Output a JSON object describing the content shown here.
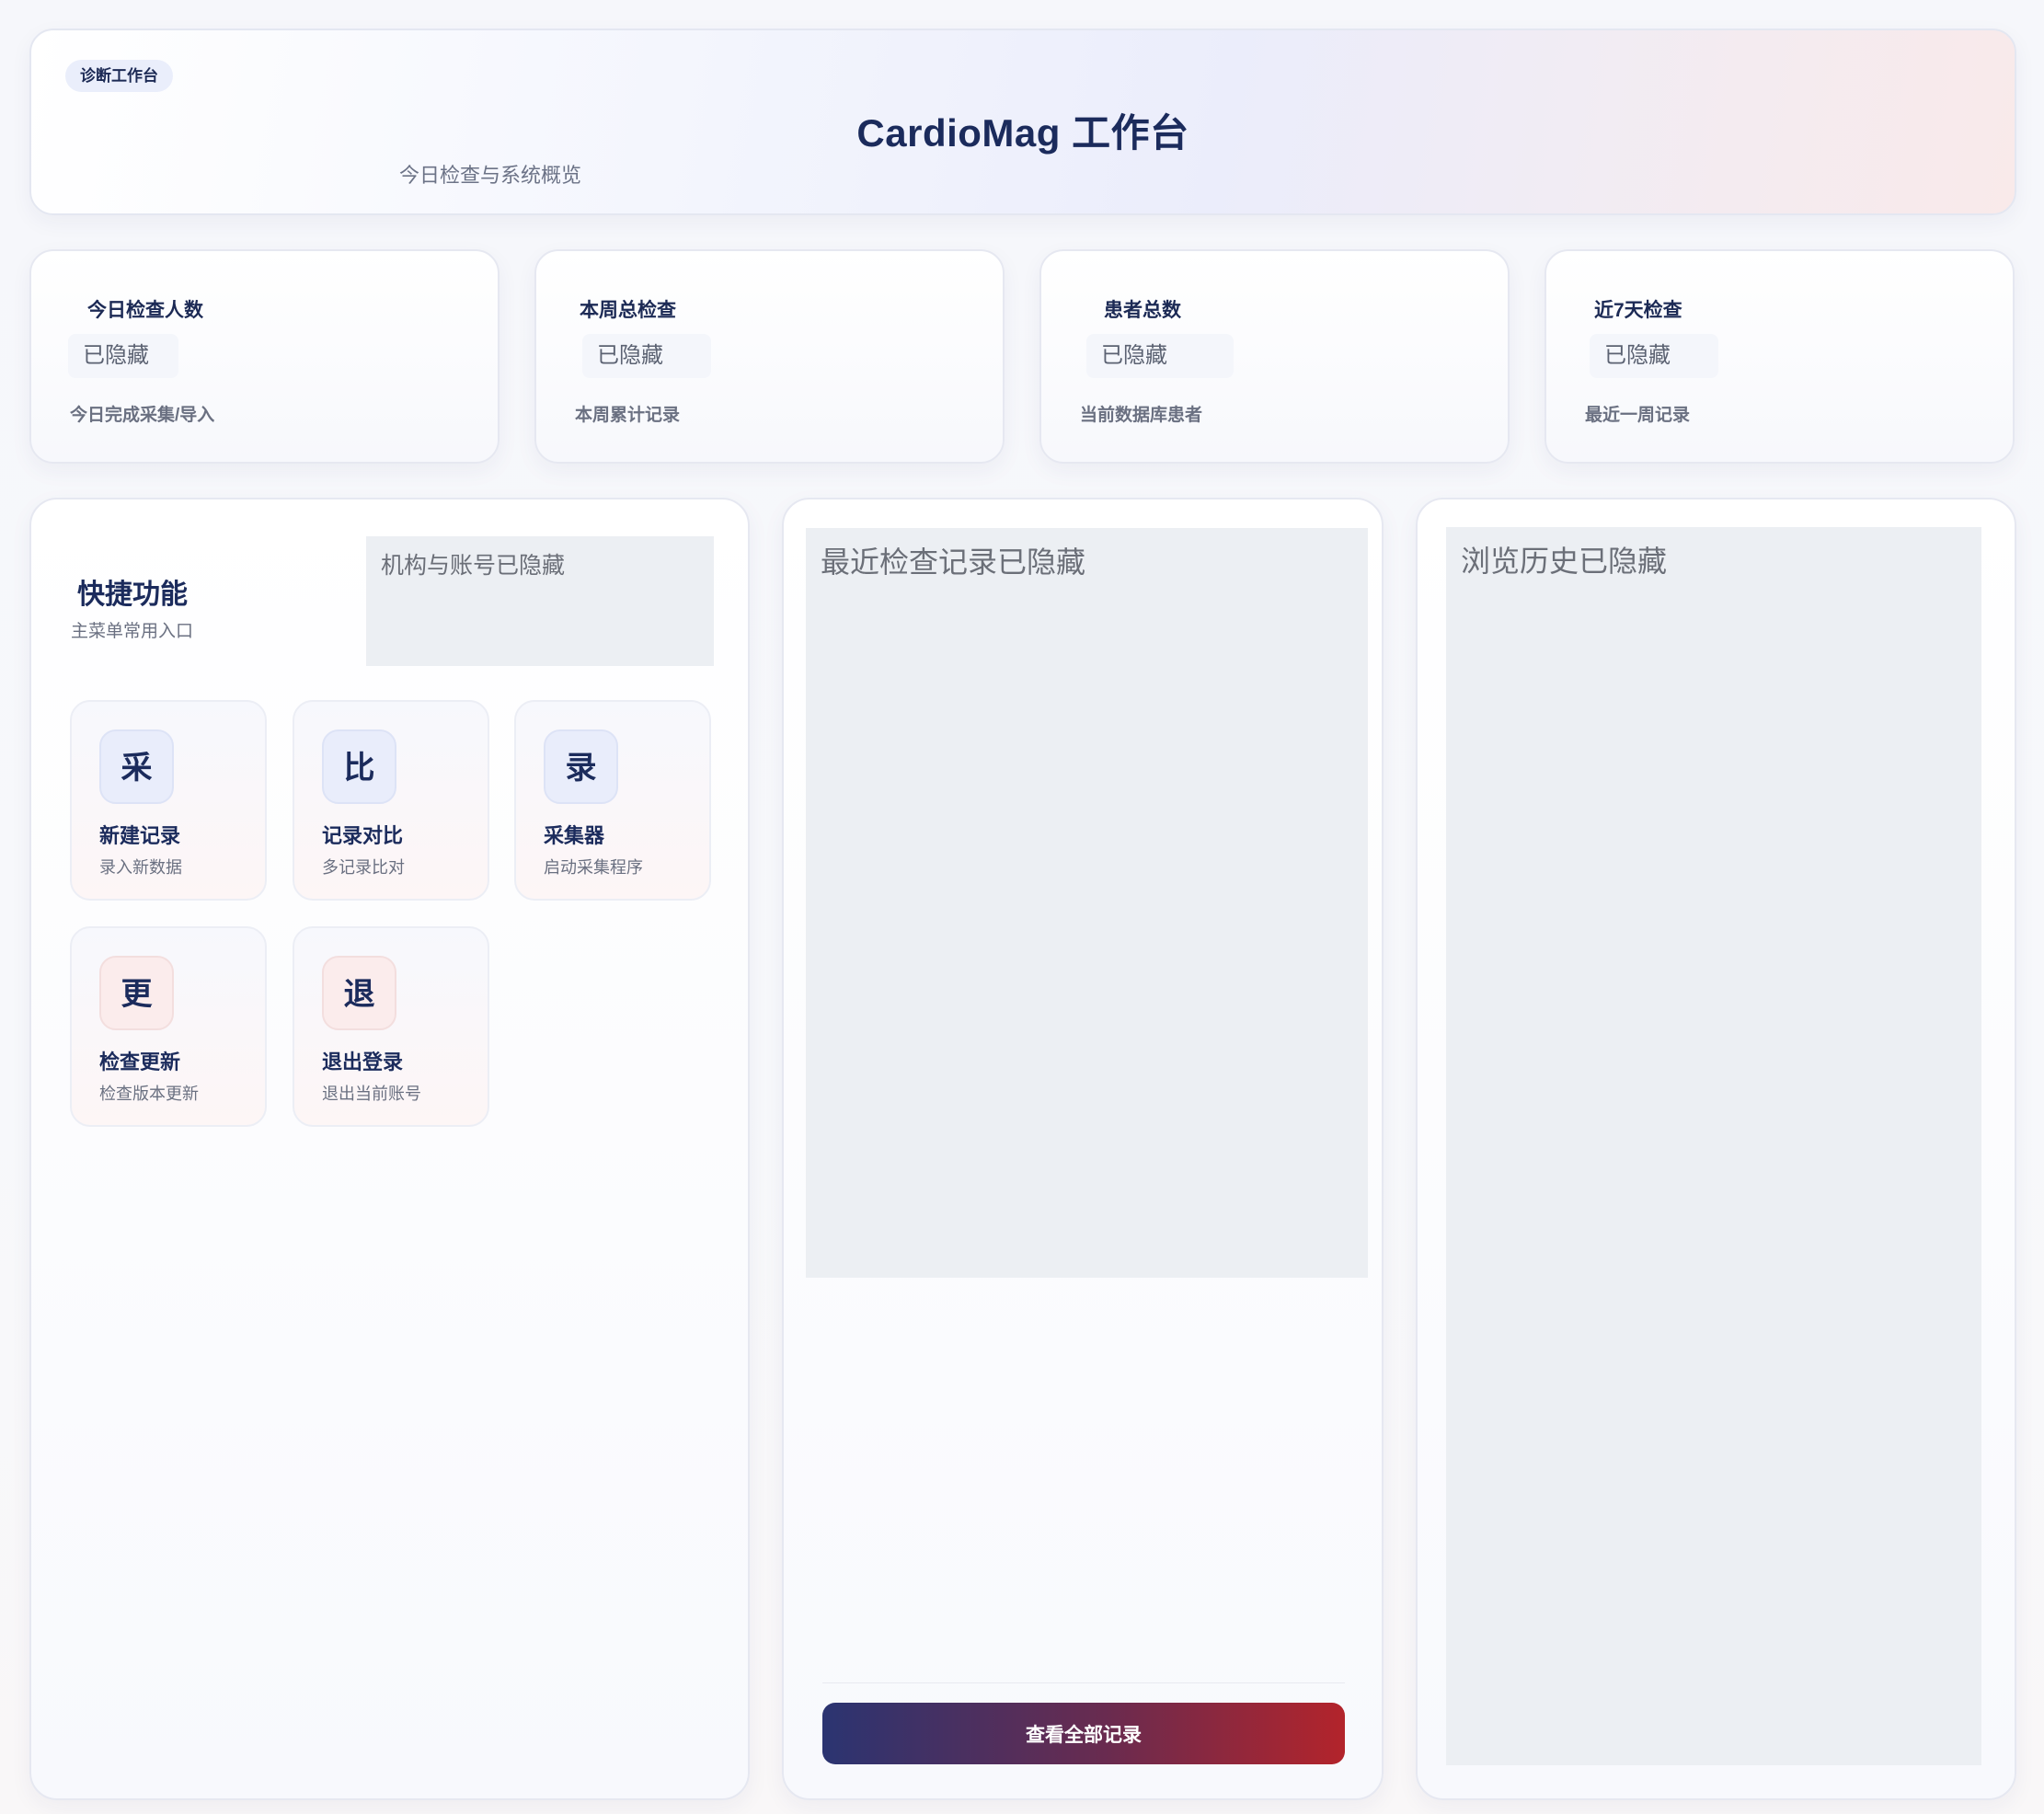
{
  "header": {
    "badge": "诊断工作台",
    "title": "CardioMag 工作台",
    "subtitle": "今日检查与系统概览"
  },
  "stats": [
    {
      "label": "今日检查人数",
      "value": "已隐藏",
      "desc": "今日完成采集/导入"
    },
    {
      "label": "本周总检查",
      "value": "已隐藏",
      "desc": "本周累计记录"
    },
    {
      "label": "患者总数",
      "value": "已隐藏",
      "desc": "当前数据库患者"
    },
    {
      "label": "近7天检查",
      "value": "已隐藏",
      "desc": "最近一周记录"
    }
  ],
  "quick": {
    "title": "快捷功能",
    "subtitle": "主菜单常用入口",
    "org_hidden": "机构与账号已隐藏",
    "tiles": [
      {
        "icon": "采",
        "title": "新建记录",
        "desc": "录入新数据"
      },
      {
        "icon": "比",
        "title": "记录对比",
        "desc": "多记录比对"
      },
      {
        "icon": "录",
        "title": "采集器",
        "desc": "启动采集程序"
      },
      {
        "icon": "更",
        "title": "检查更新",
        "desc": "检查版本更新"
      },
      {
        "icon": "退",
        "title": "退出登录",
        "desc": "退出当前账号"
      }
    ]
  },
  "recent": {
    "hidden_text": "最近检查记录已隐藏",
    "button_label": "查看全部记录"
  },
  "history": {
    "hidden_text": "浏览历史已隐藏"
  }
}
